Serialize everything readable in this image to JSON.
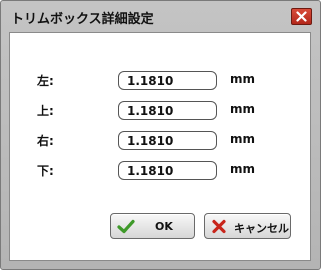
{
  "window": {
    "title": "トリムボックス詳細設定"
  },
  "fields": [
    {
      "label": "左:",
      "value": "1.1810",
      "unit": "mm"
    },
    {
      "label": "上:",
      "value": "1.1810",
      "unit": "mm"
    },
    {
      "label": "右:",
      "value": "1.1810",
      "unit": "mm"
    },
    {
      "label": "下:",
      "value": "1.1810",
      "unit": "mm"
    }
  ],
  "buttons": {
    "ok_label": "OK",
    "cancel_label": "キャンセル"
  },
  "icons": {
    "ok": "check-icon",
    "cancel": "x-icon",
    "close": "close-icon"
  },
  "colors": {
    "ok_icon": "#3f9a2a",
    "cancel_icon": "#c8251b",
    "close_button": "#c13a2a"
  }
}
